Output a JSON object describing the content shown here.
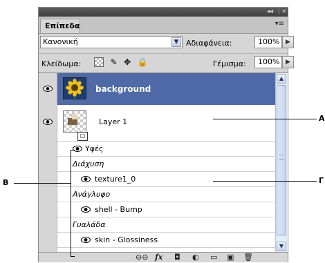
{
  "panel": {
    "window_controls": {
      "collapse": "◂◂",
      "close": "×"
    },
    "tab_label": "Επίπεδα",
    "menu_icon": "panel-menu-icon",
    "blend_mode": "Κανονική",
    "opacity_label": "Αδιαφάνεια:",
    "opacity_value": "100%",
    "lock_label": "Κλείδωμα:",
    "fill_label": "Γέμισμα:",
    "fill_value": "100%"
  },
  "layers": [
    {
      "name": "background",
      "visible": true,
      "selected": true
    },
    {
      "name": "Layer 1",
      "visible": true,
      "selected": false
    }
  ],
  "effects_header": "Υφές",
  "effects": [
    {
      "category": "Διάχυση",
      "item": "texture1_0"
    },
    {
      "category": "Ανάγλυφο",
      "item": "shell - Bump"
    },
    {
      "category": "Γυαλάδα",
      "item": "skin - Glossiness"
    }
  ],
  "bottom_icons": [
    "link-icon",
    "fx-icon",
    "mask-icon",
    "adjustment-icon",
    "folder-icon",
    "new-layer-icon",
    "trash-icon"
  ],
  "callouts": {
    "a": "A",
    "b": "B",
    "c": "Γ"
  }
}
